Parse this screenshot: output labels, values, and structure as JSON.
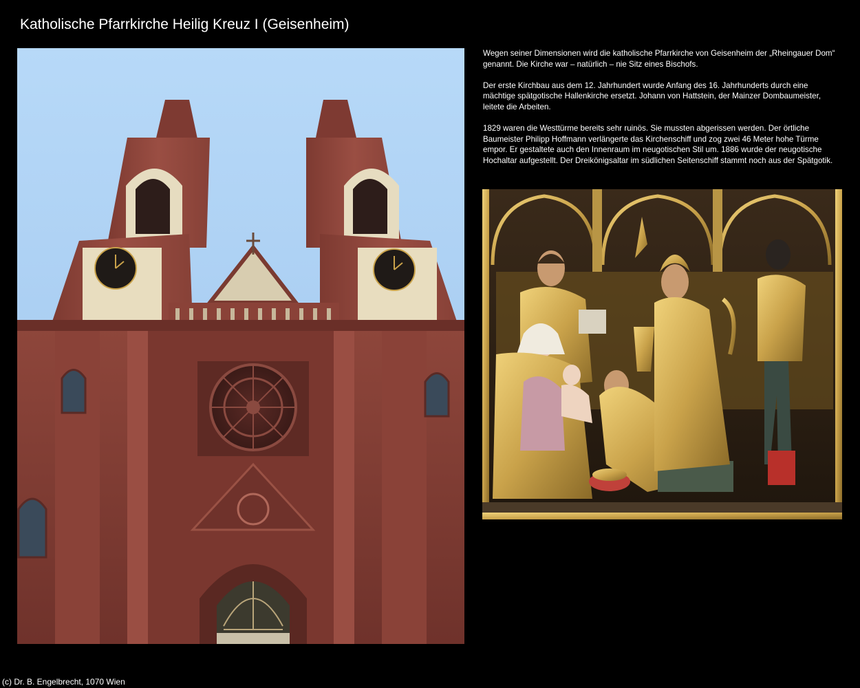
{
  "page": {
    "title": "Katholische Pfarrkirche Heilig Kreuz I (Geisenheim)",
    "footer": "(c) Dr. B. Engelbrecht, 1070 Wien"
  },
  "text": {
    "paragraphs": [
      "Wegen seiner Dimensionen wird die katholische Pfarrkirche von Geisenheim der „Rheingauer Dom“ genannt. Die Kirche war – natürlich – nie Sitz eines Bischofs.",
      "Der erste Kirchbau aus dem 12. Jahrhundert wurde Anfang des 16. Jahrhunderts durch eine mächtige spätgotische Hallenkirche ersetzt. Johann von Hattstein, der Mainzer Dombaumeister, leitete die Arbeiten.",
      "1829 waren die Westtürme bereits sehr ruinös. Sie mussten abgerissen werden. Der örtliche Baumeister Philipp Hoffmann verlängerte das Kirchenschiff und zog zwei 46 Meter hohe Türme empor. Er gestaltete auch den Innenraum im neugotischen Stil um. 1886 wurde der neugotische Hochaltar aufgestellt. Der Dreikönigsaltar im südlichen Seitenschiff stammt noch aus der Spätgotik."
    ]
  },
  "colors": {
    "background": "#000000",
    "text": "#ffffff",
    "sky": "#a9cdf0",
    "sandstone": "#9a4e43",
    "gold": "#c9a24a"
  }
}
